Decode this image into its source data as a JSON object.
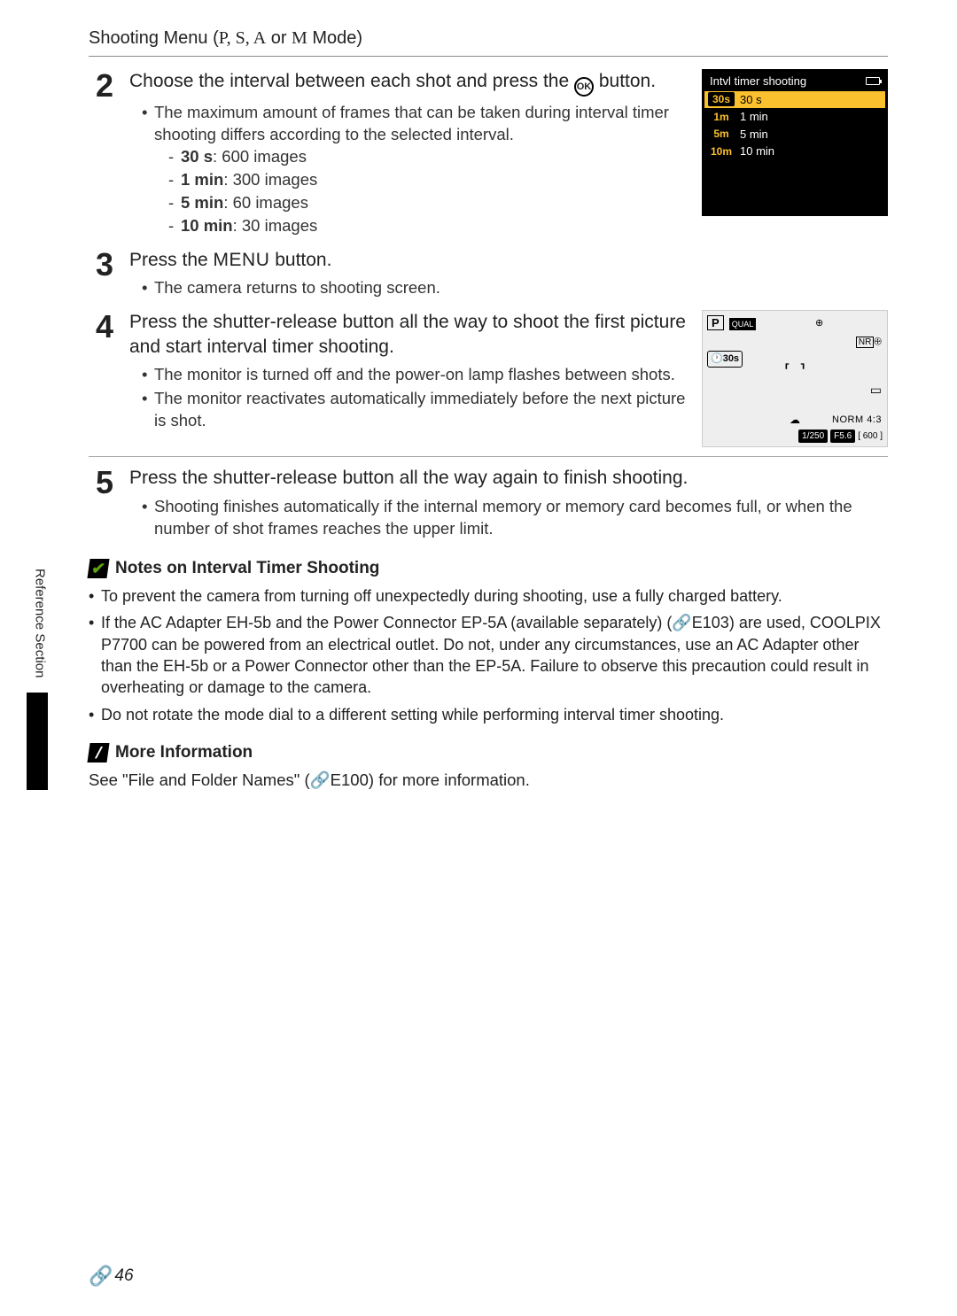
{
  "header": {
    "title_prefix": "Shooting Menu (",
    "modes": "P, S, A",
    "modes_or": " or ",
    "mode_m": "M",
    "title_suffix": " Mode)"
  },
  "steps": {
    "s2": {
      "num": "2",
      "heading_a": "Choose the interval between each shot and press the ",
      "heading_b": " button.",
      "bullet1": "The maximum amount of frames that can be taken during interval timer shooting differs according to the selected interval.",
      "opt1_b": "30 s",
      "opt1_r": ": 600 images",
      "opt2_b": "1 min",
      "opt2_r": ": 300 images",
      "opt3_b": "5 min",
      "opt3_r": ": 60 images",
      "opt4_b": "10 min",
      "opt4_r": ": 30 images"
    },
    "s3": {
      "num": "3",
      "heading_a": "Press the ",
      "menu_word": "MENU",
      "heading_b": " button.",
      "bullet1": "The camera returns to shooting screen."
    },
    "s4": {
      "num": "4",
      "heading": "Press the shutter-release button all the way to shoot the first picture and start interval timer shooting.",
      "bullet1": "The monitor is turned off and the power-on lamp flashes between shots.",
      "bullet2": "The monitor reactivates automatically immediately before the next picture is shot."
    },
    "s5": {
      "num": "5",
      "heading": "Press the shutter-release button all the way again to finish shooting.",
      "bullet1": "Shooting finishes automatically if the internal memory or memory card becomes full, or when the number of shot frames reaches the upper limit."
    }
  },
  "lcd_menu": {
    "title": "Intvl timer shooting",
    "rows": [
      {
        "icon": "30s",
        "label": "30 s",
        "selected": true
      },
      {
        "icon": "1m",
        "label": "1 min",
        "selected": false
      },
      {
        "icon": "5m",
        "label": "5 min",
        "selected": false
      },
      {
        "icon": "10m",
        "label": "10 min",
        "selected": false
      }
    ]
  },
  "lcd_shoot": {
    "p": "P",
    "qual": "QUAL",
    "nr": "NR",
    "interval": "🕐30s",
    "shutter": "1/250",
    "fstop": "F5.6",
    "frames": "[ 600 ]",
    "norm": "NORM 4:3"
  },
  "notes": {
    "heading": "Notes on Interval Timer Shooting",
    "n1": "To prevent the camera from turning off unexpectedly during shooting, use a fully charged battery.",
    "n2_a": "If the AC Adapter EH-5b and the Power Connector EP-5A (available separately) (",
    "n2_ref": "E103",
    "n2_b": ") are used, COOLPIX P7700 can be powered from an electrical outlet. Do not, under any circumstances, use an AC Adapter other than the EH-5b or a Power Connector other than the EP-5A. Failure to observe this precaution could result in overheating or damage to the camera.",
    "n3": "Do not rotate the mode dial to a different setting while performing interval timer shooting."
  },
  "more_info": {
    "heading": "More Information",
    "text_a": "See \"File and Folder Names\" (",
    "ref": "E100",
    "text_b": ") for more information."
  },
  "side_label": "Reference Section",
  "page_number": "46",
  "ok_label": "OK"
}
